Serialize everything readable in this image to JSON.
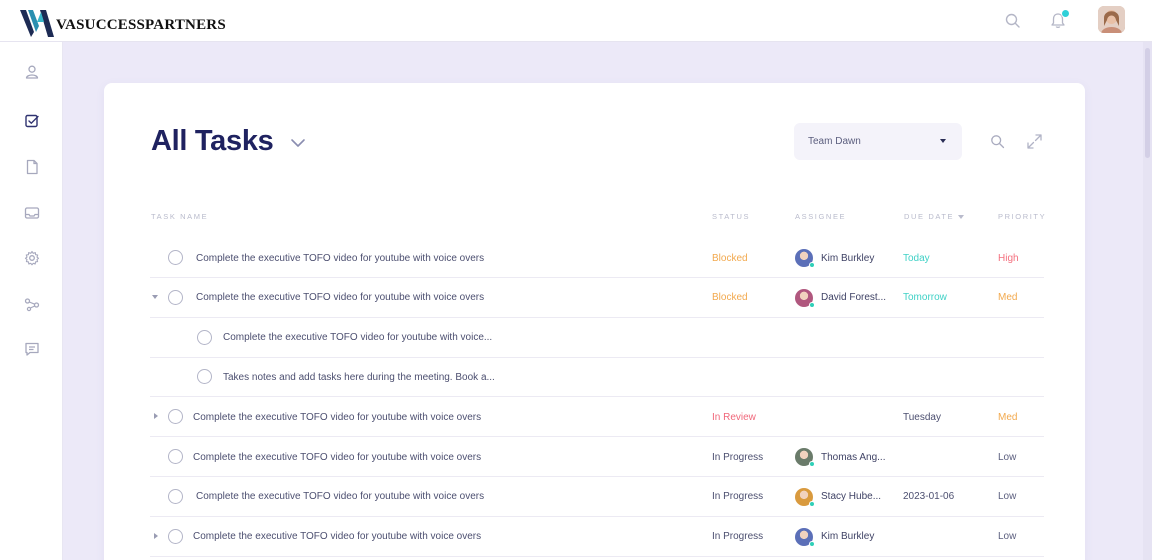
{
  "brand": {
    "name": "VASUCCESSPARTNERS"
  },
  "topbar": {
    "search_icon": "search-icon",
    "notifications_icon": "bell-icon",
    "notification_badge_color": "#2fd0d8",
    "avatar": "user-avatar"
  },
  "sidebar": {
    "items": [
      {
        "icon": "user-icon"
      },
      {
        "icon": "tasks-icon",
        "active": true
      },
      {
        "icon": "document-icon"
      },
      {
        "icon": "inbox-icon"
      },
      {
        "icon": "settings-icon"
      },
      {
        "icon": "share-icon"
      },
      {
        "icon": "chat-icon"
      }
    ]
  },
  "main": {
    "title": "All Tasks",
    "team_select": {
      "value": "Team Dawn"
    },
    "columns": {
      "task_name": "TASK NAME",
      "status": "STATUS",
      "assignee": "ASSIGNEE",
      "due_date": "DUE DATE",
      "priority": "PRIORITY"
    },
    "rows": [
      {
        "expander": "",
        "task": "Complete the executive TOFO video for youtube with voice overs",
        "status": "Blocked",
        "status_color": "#f2a94e",
        "assignee": "Kim Burkley",
        "avatar_color": "#5b6fb8",
        "due": "Today",
        "due_color": "#3fd1c6",
        "priority": "High",
        "priority_color": "#f4707f"
      },
      {
        "expander": "down",
        "task": "Complete the executive TOFO video for youtube with voice overs",
        "status": "Blocked",
        "status_color": "#f2a94e",
        "assignee": "David Forest...",
        "avatar_color": "#b0577e",
        "due": "Tomorrow",
        "due_color": "#3fd1c6",
        "priority": "Med",
        "priority_color": "#f2a94e"
      },
      {
        "expander": "",
        "subtask": true,
        "task": "Complete the executive TOFO video for youtube with voice...",
        "status": "",
        "assignee": "",
        "due": "",
        "priority": ""
      },
      {
        "expander": "",
        "subtask": true,
        "task": "Takes notes and add tasks here during the meeting. Book a...",
        "status": "",
        "assignee": "",
        "due": "",
        "priority": ""
      },
      {
        "expander": "right",
        "task": "Complete the executive TOFO video for youtube with voice overs",
        "status": "In Review",
        "status_color": "#f0677a",
        "assignee": "",
        "due": "Tuesday",
        "due_color": "#4c4f70",
        "priority": "Med",
        "priority_color": "#f2a94e"
      },
      {
        "expander": "",
        "task": "Complete the executive TOFO video for youtube with voice overs",
        "status": "In Progress",
        "status_color": "#4c4f70",
        "assignee": "Thomas Ang...",
        "avatar_color": "#6a7b6a",
        "due": "",
        "priority": "Low",
        "priority_color": "#5b5e7e"
      },
      {
        "expander": "",
        "task": "Complete the executive TOFO video for youtube with voice overs",
        "status": "In Progress",
        "status_color": "#4c4f70",
        "assignee": "Stacy Hube...",
        "avatar_color": "#d99a3e",
        "due": "2023-01-06",
        "due_color": "#4c4f70",
        "priority": "Low",
        "priority_color": "#5b5e7e"
      },
      {
        "expander": "right",
        "task": "Complete the executive TOFO video for youtube with voice overs",
        "status": "In Progress",
        "status_color": "#4c4f70",
        "assignee": "Kim Burkley",
        "avatar_color": "#5b6fb8",
        "due": "",
        "priority": "Low",
        "priority_color": "#5b5e7e"
      }
    ]
  }
}
